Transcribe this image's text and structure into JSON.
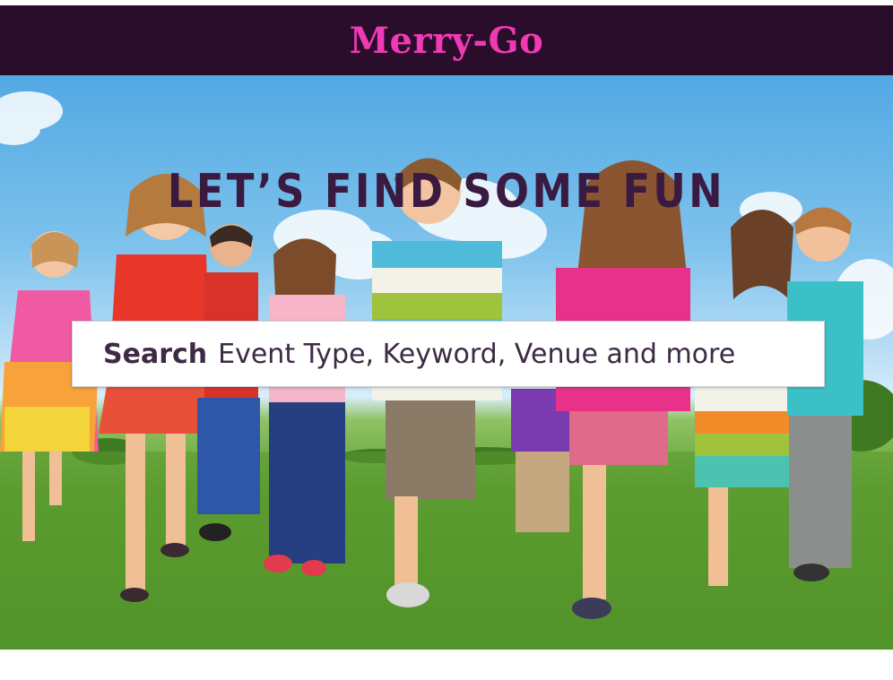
{
  "header": {
    "brand": "Merry-Go",
    "background_color": "#2a0d2a",
    "brand_color": "#f03ab4"
  },
  "hero": {
    "headline": "LET’S FIND SOME FUN",
    "headline_color": "#3a1a40",
    "image_description_icon": "children-running-photo"
  },
  "search": {
    "label": "Search",
    "placeholder": "Event Type, Keyword, Venue and more"
  }
}
